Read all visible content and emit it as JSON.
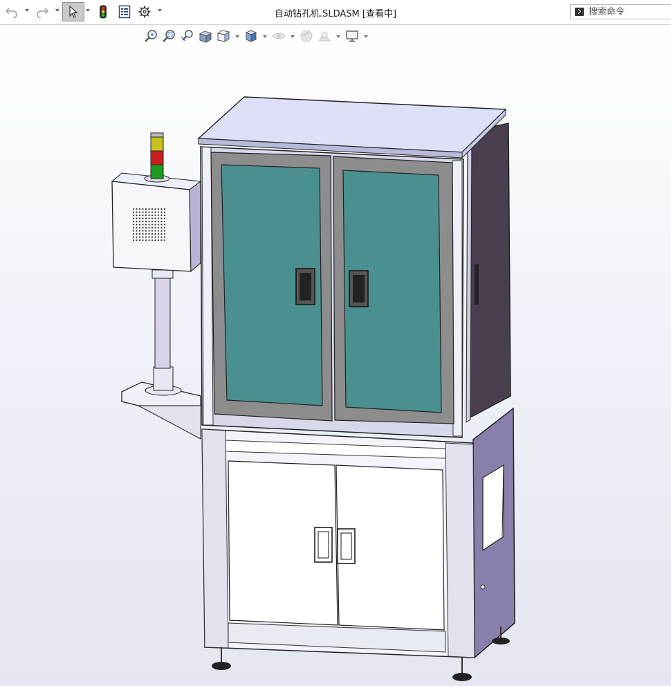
{
  "window": {
    "title": "自动钻孔机.SLDASM [查看中]"
  },
  "toolbar": {
    "icons": [
      "undo-icon",
      "redo-icon",
      "select-pointer-icon",
      "traffic-light-icon",
      "file-properties-icon",
      "options-gear-icon"
    ]
  },
  "search": {
    "placeholder": "搜索命令"
  },
  "view_toolbar": {
    "icons": [
      "zoom-to-fit-icon",
      "zoom-to-area-icon",
      "previous-view-icon",
      "section-view-icon",
      "view-orientation-icon",
      "display-style-icon",
      "hide-show-items-icon",
      "edit-appearance-icon",
      "apply-scene-icon",
      "view-settings-icon"
    ]
  },
  "model": {
    "name": "automatic-drilling-machine",
    "colors": {
      "glass": "#4a9090",
      "frame": "#d8d8ea",
      "side_panel": "#8a7eab",
      "side_dark": "#4a3f4f",
      "top": "#dde0f7",
      "light_red": "#c81e1e",
      "light_yellow": "#c8c020",
      "light_green": "#1e9a1e"
    }
  }
}
